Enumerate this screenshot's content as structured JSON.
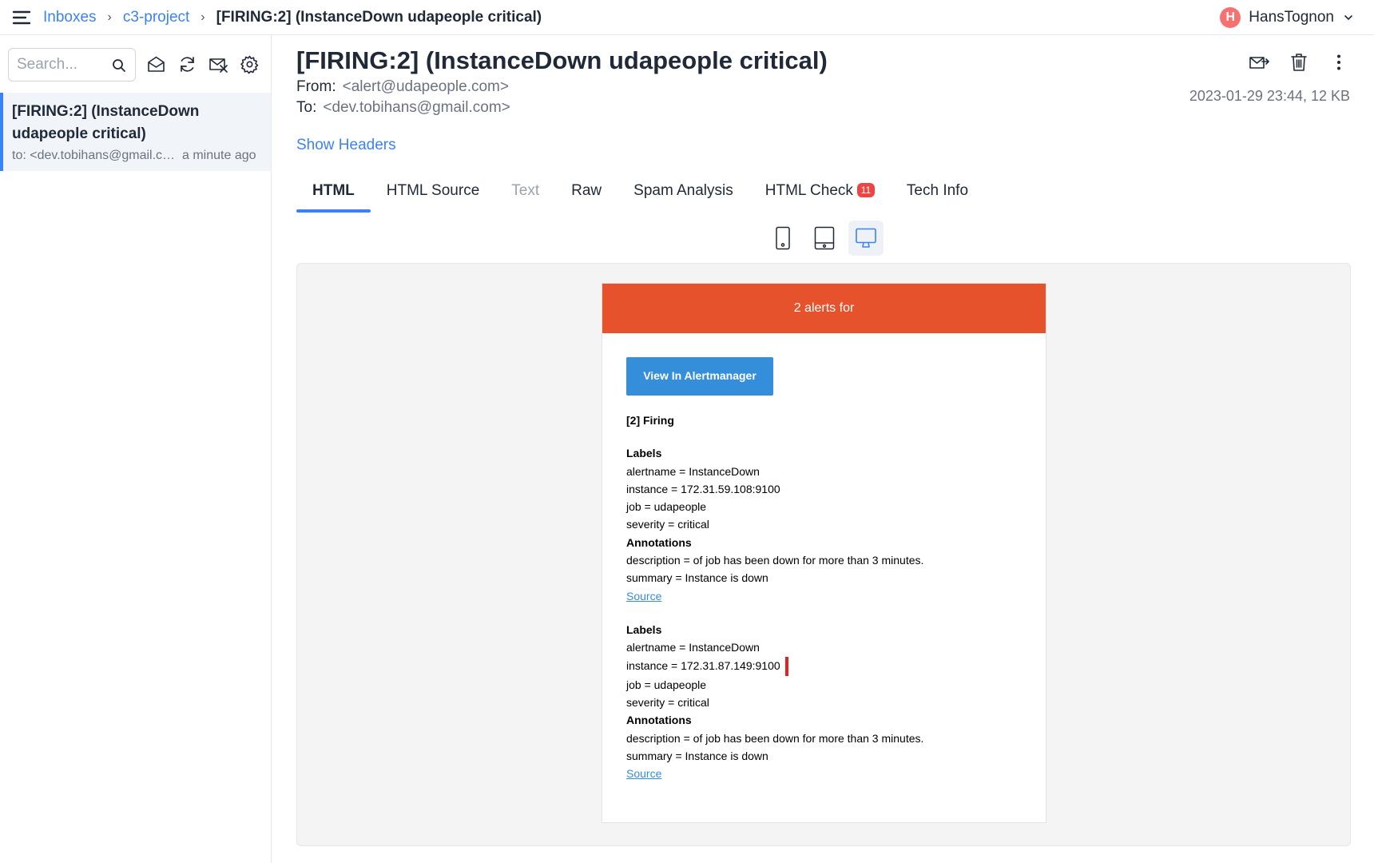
{
  "breadcrumb": {
    "items": [
      "Inboxes",
      "c3-project"
    ],
    "current": "[FIRING:2] (InstanceDown udapeople critical)"
  },
  "user": {
    "initial": "H",
    "name": "HansTognon"
  },
  "sidebar": {
    "search_placeholder": "Search...",
    "message": {
      "subject": "[FIRING:2] (InstanceDown udapeople critical)",
      "to": "to: <dev.tobihans@gmail.com>",
      "time": "a minute ago"
    }
  },
  "email": {
    "subject": "[FIRING:2] (InstanceDown udapeople critical)",
    "from_label": "From:",
    "from": "<alert@udapeople.com>",
    "to_label": "To:",
    "to": "<dev.tobihans@gmail.com>",
    "meta": "2023-01-29 23:44, 12 KB",
    "show_headers": "Show Headers"
  },
  "tabs": [
    {
      "label": "HTML",
      "state": "active"
    },
    {
      "label": "HTML Source",
      "state": "normal"
    },
    {
      "label": "Text",
      "state": "disabled"
    },
    {
      "label": "Raw",
      "state": "normal"
    },
    {
      "label": "Spam Analysis",
      "state": "normal"
    },
    {
      "label": "HTML Check",
      "state": "normal",
      "badge": "11"
    },
    {
      "label": "Tech Info",
      "state": "normal"
    }
  ],
  "preview": {
    "header": "2 alerts for",
    "button": "View In Alertmanager",
    "firing": "[2] Firing",
    "alerts": [
      {
        "labels_title": "Labels",
        "labels": [
          "alertname = InstanceDown",
          "instance = 172.31.59.108:9100",
          "job = udapeople",
          "severity = critical"
        ],
        "annotations_title": "Annotations",
        "annotations": [
          "description = of job has been down for more than 3 minutes.",
          "summary = Instance is down"
        ],
        "source": "Source"
      },
      {
        "labels_title": "Labels",
        "labels": [
          "alertname = InstanceDown",
          "instance = 172.31.87.149:9100",
          "job = udapeople",
          "severity = critical"
        ],
        "annotations_title": "Annotations",
        "annotations": [
          "description = of job has been down for more than 3 minutes.",
          "summary = Instance is down"
        ],
        "source": "Source"
      }
    ]
  },
  "colors": {
    "accent": "#3b82f6",
    "alert_header": "#e6522c",
    "button": "#348eda",
    "badge": "#ef4444"
  }
}
